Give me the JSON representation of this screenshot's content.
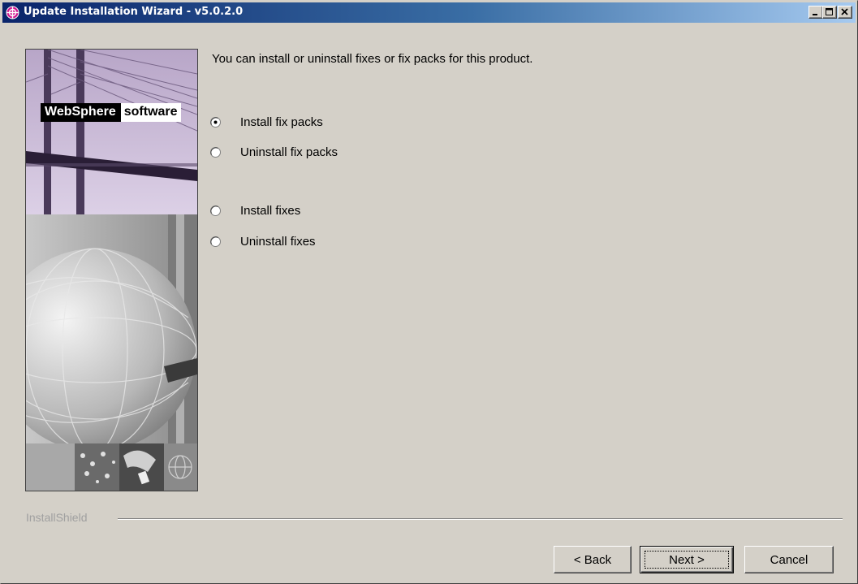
{
  "window": {
    "title": "Update Installation Wizard - v5.0.2.0",
    "controls": [
      "minimize-icon",
      "maximize-icon",
      "close-icon"
    ]
  },
  "side_panel": {
    "brand_primary": "WebSphere",
    "brand_secondary": "software"
  },
  "main": {
    "intro": "You can install or uninstall fixes or fix packs for this product.",
    "options": [
      {
        "label": "Install fix packs",
        "selected": true
      },
      {
        "label": "Uninstall fix packs",
        "selected": false
      },
      {
        "label": "Install fixes",
        "selected": false
      },
      {
        "label": "Uninstall fixes",
        "selected": false
      }
    ]
  },
  "footer": {
    "vendor": "InstallShield",
    "back_label": "< Back",
    "next_label": "Next >",
    "cancel_label": "Cancel"
  },
  "colors": {
    "title_bar_start": "#0a246a",
    "title_bar_end": "#a6caf0",
    "dialog_bg": "#d4d0c8",
    "brand_purple": "#c8b8d8"
  }
}
